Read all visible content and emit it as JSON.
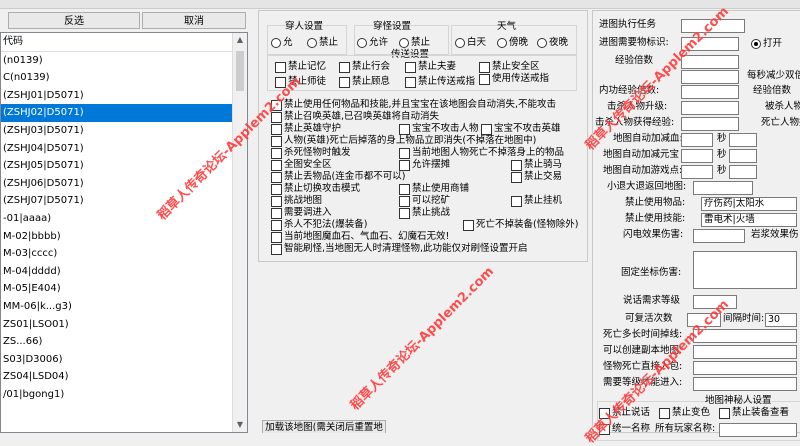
{
  "top": {
    "invert_label": "反选",
    "cancel_label": "取消"
  },
  "list": {
    "header": "代码",
    "rows": [
      "(n0139)",
      "C(n0139)",
      "(ZSHJ01|D5071)",
      "(ZSHJ02|D5071)",
      "(ZSHJ03|D5071)",
      "(ZSHJ04|D5071)",
      "(ZSHJ05|D5071)",
      "(ZSHJ06|D5071)",
      "(ZSHJ07|D5071)",
      "-01|aaaa)",
      "M-02|bbbb)",
      "M-03|cccc)",
      "M-04|dddd)",
      "M-05|E404)",
      "MM-06|k...g3)",
      "ZS01|LSO01)",
      "ZS...66)",
      "S03|D3006)",
      "ZS04|LSD04)",
      "/01|bgong1)"
    ],
    "selected_index": 3
  },
  "mid": {
    "sections": {
      "wear": "穿人设置",
      "wear2": "穿怪设置",
      "weather": "天气",
      "transfer": "传送设置"
    },
    "radios": [
      {
        "id": "r1",
        "label": "允",
        "on": false
      },
      {
        "id": "r2",
        "label": "禁止",
        "on": false
      },
      {
        "id": "r3",
        "label": "允许",
        "on": false
      },
      {
        "id": "r4",
        "label": "禁止",
        "on": false
      },
      {
        "id": "r5",
        "label": "白天",
        "on": false
      },
      {
        "id": "r6",
        "label": "傍晚",
        "on": false
      },
      {
        "id": "r7",
        "label": "夜晚",
        "on": false
      }
    ],
    "checks": [
      "禁止记忆",
      "禁止行会",
      "禁止夫妻",
      "禁止安全区",
      "禁止师徒",
      "禁止顾息",
      "禁止传送戒指",
      "使用传送戒指",
      "禁止使用任何物品和技能,并且宝宝在该地图会自动消失,不能攻击",
      "禁止召唤英雄,已召唤英雄将自动消失",
      "禁止英雄守护",
      "宝宝不攻击人物",
      "宝宝不攻击英雄",
      "人物(英雄)死亡后掉落的身上物品立即消失(不掉落在地图中)",
      "杀死怪物时触发",
      "当前地图人物死亡不掉落身上的物品",
      "全图安全区",
      "允许摆摊",
      "禁止骑马",
      "禁止丢物品(连金币都不可以)",
      "禁止交易",
      "禁止切换攻击模式",
      "禁止使用商铺",
      "挑战地图",
      "可以挖矿",
      "禁止挂机",
      "需要调进入",
      "禁止挑战",
      "杀人不犯法(爆装备)",
      "死亡不掉装备(怪物除外)",
      "当前地图魔血石、气血石、幻魔石无效!",
      "智能刷怪,当地图无人时清理怪物,此功能仅对刷怪设置开启"
    ],
    "bottom_btn": "加载该地图(需关闭后重置地"
  },
  "right": {
    "rows": [
      "进图执行任务",
      "进图需要物标识:",
      "打开",
      "经验倍数",
      "每秒减少双倍",
      "内功经验倍数:",
      "经验倍数",
      "击杀人物升级:",
      "被杀人物",
      "击杀人物获得经验:",
      "死亡人物掉",
      "地图自动加减血:",
      "秒",
      "地图自动加减元宝",
      "秒",
      "地图自动加游戏点:",
      "秒",
      "小退大退返回地图:",
      "禁止使用物品:",
      "疗伤药|太阳水",
      "禁止使用技能:",
      "雷电术|火墙",
      "闪电效果伤害:",
      "岩浆效果伤",
      "固定坐标伤害:",
      "说话需求等级",
      "可复活次数",
      "间隔时间:",
      "30",
      "死亡多长时间掉线:",
      "可以创建副本地图:",
      "怪物死亡直接入包:",
      "需要等级才能进入:",
      "地图神秘人设置",
      "禁止说话",
      "禁止变色",
      "禁止装备查看",
      "统一名称",
      "所有玩家名称:"
    ]
  },
  "watermark": "稻草人传奇论坛-Applem2.com"
}
